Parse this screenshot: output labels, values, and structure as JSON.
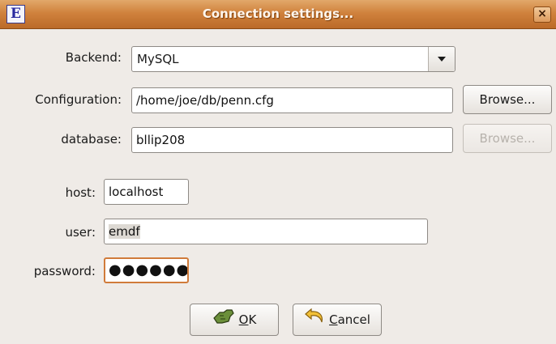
{
  "window": {
    "title": "Connection settings...",
    "app_icon_letter": "E",
    "close_glyph": "×"
  },
  "form": {
    "backend": {
      "label": "Backend:",
      "value": "MySQL"
    },
    "configuration": {
      "label": "Configuration:",
      "value": "/home/joe/db/penn.cfg",
      "browse_label": "Browse..."
    },
    "database": {
      "label": "database:",
      "value": "bllip208",
      "browse_label": "Browse...",
      "browse_enabled": false
    },
    "host": {
      "label": "host:",
      "value": "localhost"
    },
    "user": {
      "label": "user:",
      "value": "emdf"
    },
    "password": {
      "label": "password:",
      "masked_value": "●●●●●●"
    }
  },
  "buttons": {
    "ok": {
      "mnemonic": "O",
      "rest": "K",
      "icon": "ok-hand-icon"
    },
    "cancel": {
      "mnemonic": "C",
      "rest": "ancel",
      "icon": "undo-arrow-icon"
    }
  },
  "colors": {
    "titlebar": "#d0823d",
    "focus_border": "#d07b3a",
    "background": "#efebe7"
  }
}
